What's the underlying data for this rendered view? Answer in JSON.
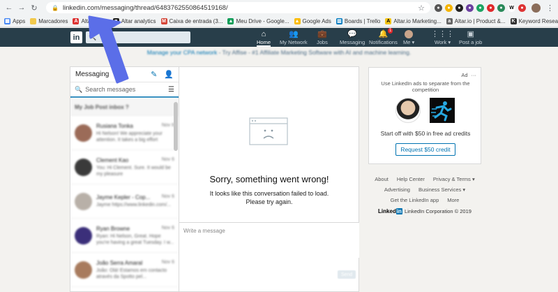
{
  "browser": {
    "url": "linkedin.com/messaging/thread/6483762550864519168/",
    "bookmarks": [
      "Apps",
      "Marcadores",
      "Altar Analy",
      "Altar analytics",
      "Caixa de entrada (3...",
      "Meu Drive - Google...",
      "Google Ads",
      "Boards | Trello",
      "Altar.io Marketing...",
      "Altar.io | Product &...",
      "Keyword Research..."
    ]
  },
  "nav": {
    "search_placeholder": "",
    "items": [
      {
        "label": "Home",
        "icon": "home-icon",
        "badge": ""
      },
      {
        "label": "My Network",
        "icon": "people-icon",
        "badge": ""
      },
      {
        "label": "Jobs",
        "icon": "briefcase-icon",
        "badge": ""
      },
      {
        "label": "Messaging",
        "icon": "chat-icon",
        "badge": ""
      },
      {
        "label": "Notifications",
        "icon": "bell-icon",
        "badge": "1"
      },
      {
        "label": "Me ▾",
        "icon": "avatar",
        "badge": ""
      },
      {
        "label": "Work ▾",
        "icon": "grid-icon",
        "badge": ""
      },
      {
        "label": "Post a job",
        "icon": "post-job-icon",
        "badge": ""
      }
    ]
  },
  "promo": {
    "link": "Manage your CPA network",
    "text": " - Try Affise - #1 Affiliate Marketing Software with AI and machine learning."
  },
  "messaging": {
    "title": "Messaging",
    "search_placeholder": "Search messages",
    "list_header": "My Job Post inbox ?",
    "conversations": [
      {
        "name": "Rusiana Tonka",
        "date": "Nov 6",
        "preview": "Hi Nelson! We appreciate your attention. It takes a big effort"
      },
      {
        "name": "Clement Kao",
        "date": "Nov 6",
        "preview": "You: Hi Clement. Sure. It would be my pleasure"
      },
      {
        "name": "Jayme Kepler - Cop...",
        "date": "Nov 6",
        "preview": "Jayme https://www.linkedin.com/..."
      },
      {
        "name": "Ryan Browne",
        "date": "Nov 6",
        "preview": "Ryan: Hi Nelson, Great. Hope you're having a great Tuesday. I w..."
      },
      {
        "name": "João Serra Amaral",
        "date": "Nov 6",
        "preview": "João: Olá! Estamos em contacto através da Spotto pel..."
      }
    ]
  },
  "conversation": {
    "error_title": "Sorry, something went wrong!",
    "error_line1": "It looks like this conversation failed to load.",
    "error_line2": "Please try again.",
    "compose_placeholder": "Write a message",
    "send_label": "Send"
  },
  "ad": {
    "label": "Ad",
    "more": "···",
    "subtitle": "Use LinkedIn ads to separate from the competition",
    "text": "Start off with $50 in free ad credits",
    "button": "Request $50 credit"
  },
  "footer": {
    "row1": [
      "About",
      "Help Center",
      "Privacy & Terms ▾"
    ],
    "row2": [
      "Advertising",
      "Business Services ▾"
    ],
    "row3": [
      "Get the LinkedIn app",
      "More"
    ],
    "copyright": "LinkedIn Corporation © 2019",
    "logo_text": "Linked",
    "logo_in": "in"
  }
}
